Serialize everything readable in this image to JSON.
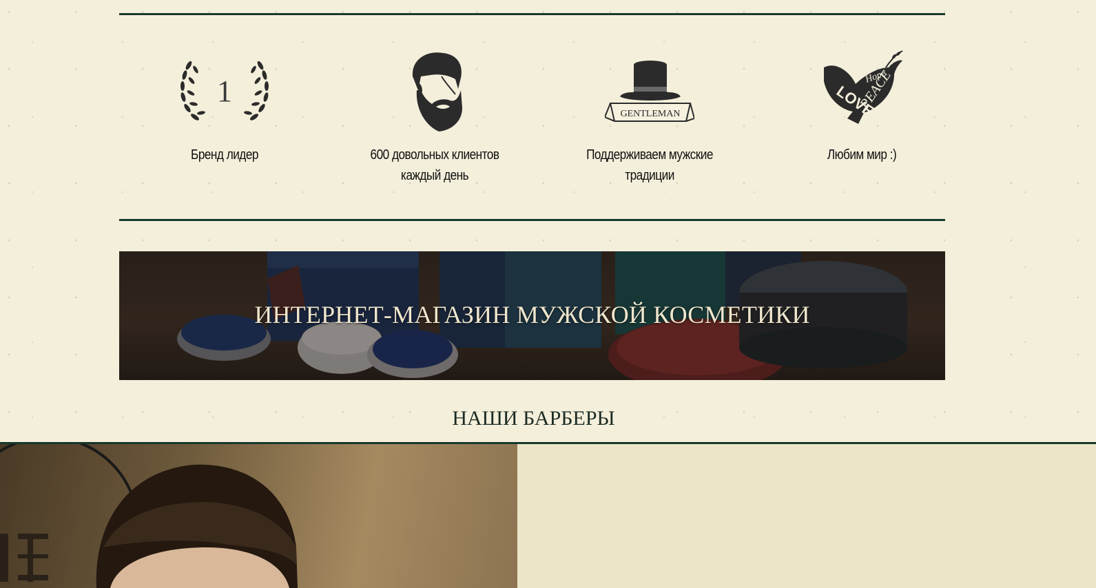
{
  "features": [
    {
      "icon": "laurel-wreath-icon",
      "number": "1",
      "label": "Бренд лидер"
    },
    {
      "icon": "bearded-man-icon",
      "label": "600 довольных клиентов каждый день"
    },
    {
      "icon": "gentleman-top-hat-icon",
      "ribbon": "GENTLEMAN",
      "label": "Поддерживаем мужские традиции"
    },
    {
      "icon": "love-dove-icon",
      "words": [
        "LOVE",
        "Hope",
        "PEACE"
      ],
      "label": "Любим мир :)"
    }
  ],
  "banner": {
    "title": "ИНТЕРНЕТ-МАГАЗИН МУЖСКОЙ КОСМЕТИКИ",
    "image": "mens-cosmetics-products-photo"
  },
  "barbers": {
    "title": "НАШИ БАРБЕРЫ",
    "photo": "barber-portrait-photo"
  },
  "colors": {
    "background": "#f4efdb",
    "rule": "#17382c",
    "panel": "#ece6c8",
    "icon": "#2a2a2a"
  }
}
